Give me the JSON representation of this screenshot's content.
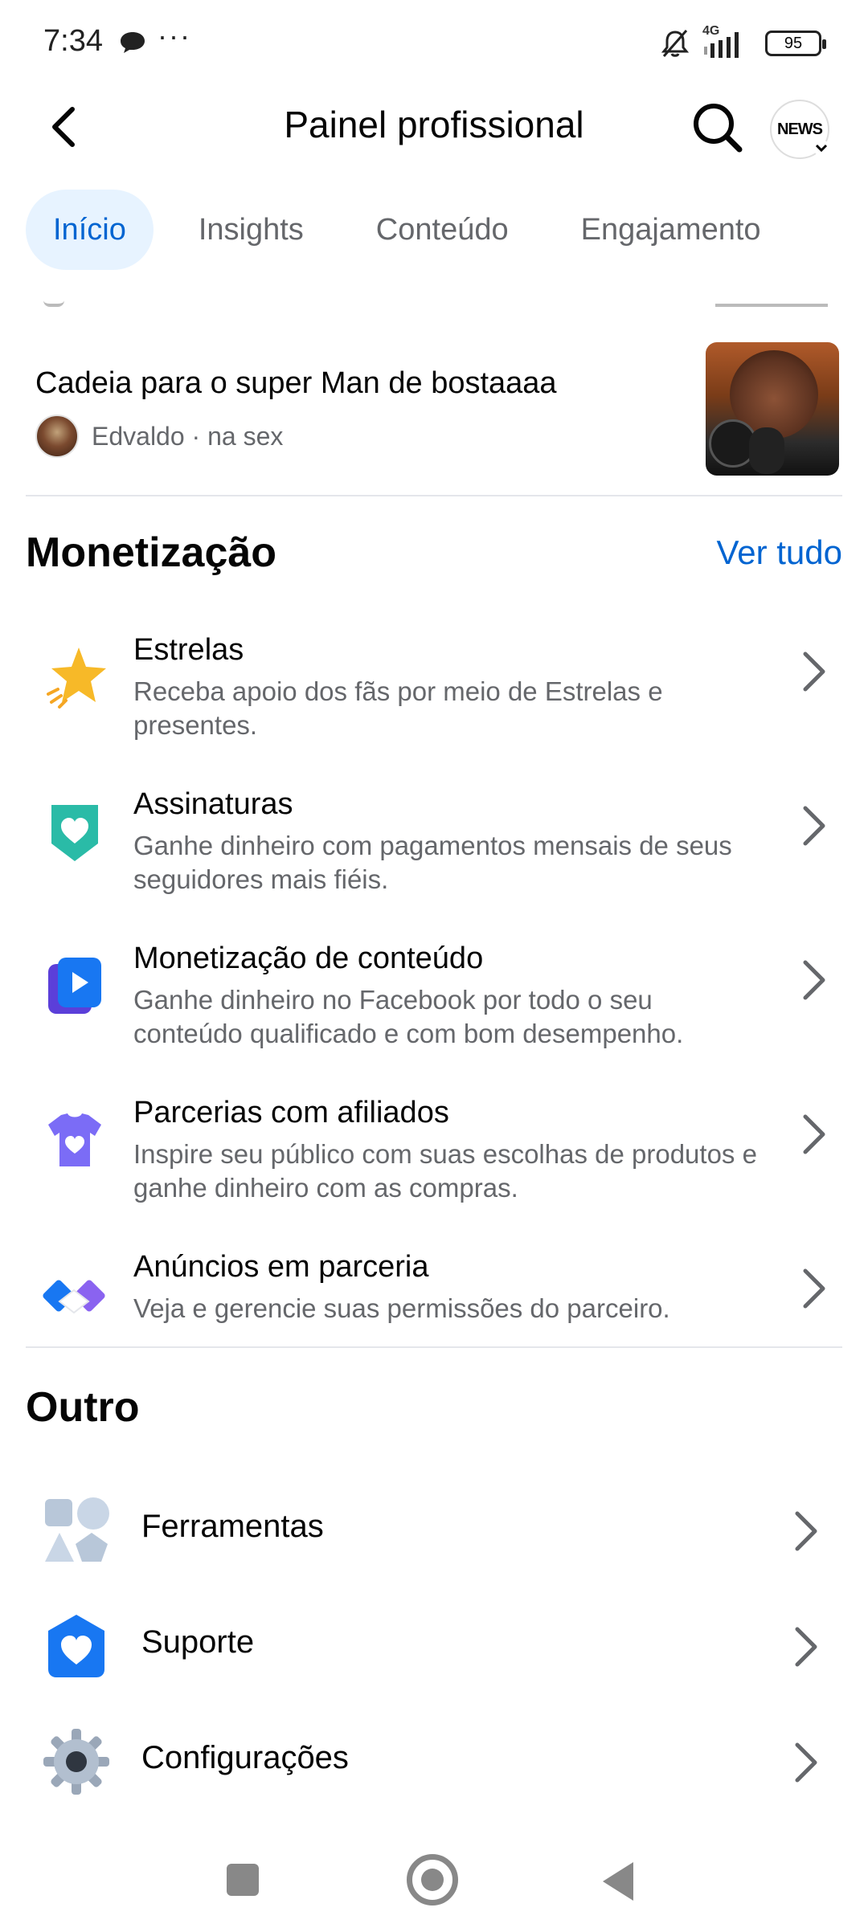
{
  "status_bar": {
    "time": "7:34",
    "dots": "···",
    "network": "4G",
    "battery": "95"
  },
  "header": {
    "title": "Painel profissional",
    "profile_badge": "NEWS"
  },
  "tabs": [
    {
      "label": "Início",
      "active": true
    },
    {
      "label": "Insights",
      "active": false
    },
    {
      "label": "Conteúdo",
      "active": false
    },
    {
      "label": "Engajamento",
      "active": false
    }
  ],
  "post": {
    "title": "Cadeia para o super Man de bostaaaa",
    "meta": "Edvaldo · na sex"
  },
  "monetization": {
    "title": "Monetização",
    "see_all": "Ver tudo",
    "items": [
      {
        "title": "Estrelas",
        "desc": "Receba apoio dos fãs por meio de Estrelas e presentes.",
        "icon": "star-icon"
      },
      {
        "title": "Assinaturas",
        "desc": "Ganhe dinheiro com pagamentos mensais de seus seguidores mais fiéis.",
        "icon": "heart-badge-icon"
      },
      {
        "title": "Monetização de conteúdo",
        "desc": "Ganhe dinheiro no Facebook por todo o seu conteúdo qualificado e com bom desempenho.",
        "icon": "play-card-icon"
      },
      {
        "title": "Parcerias com afiliados",
        "desc": "Inspire seu público com suas escolhas de produtos e ganhe dinheiro com as compras.",
        "icon": "tshirt-icon"
      },
      {
        "title": "Anúncios em parceria",
        "desc": "Veja e gerencie suas permissões do parceiro.",
        "icon": "handshake-icon"
      }
    ]
  },
  "other": {
    "title": "Outro",
    "items": [
      {
        "label": "Ferramentas",
        "icon": "tools-shapes-icon"
      },
      {
        "label": "Suporte",
        "icon": "support-heart-icon"
      },
      {
        "label": "Configurações",
        "icon": "gear-icon"
      }
    ]
  },
  "colors": {
    "accent": "#0064d1",
    "tab_active_bg": "#e7f3ff",
    "secondary_text": "#65676b"
  }
}
